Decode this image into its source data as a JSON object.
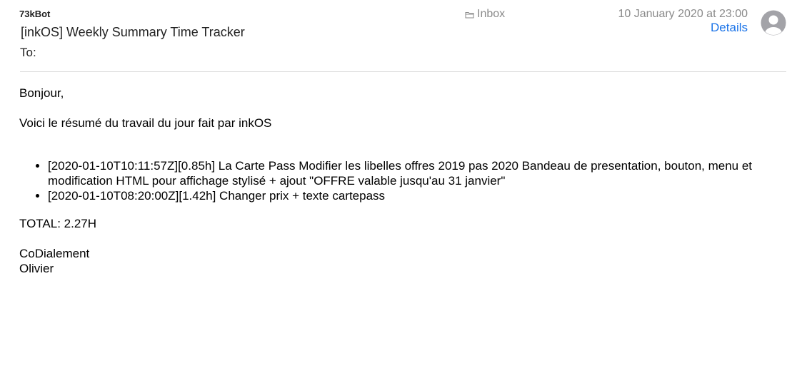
{
  "header": {
    "sender": "73kBot",
    "subject": "[inkOS] Weekly Summary Time Tracker",
    "to_label": "To:",
    "mailbox": {
      "icon": "folder-icon",
      "label": "Inbox"
    },
    "date": "10 January 2020 at 23:00",
    "details_label": "Details",
    "accent_color": "#1a73e8"
  },
  "body": {
    "greeting": "Bonjour,",
    "intro": "Voici le résumé du travail du jour fait par inkOS",
    "tasks": [
      "[2020-01-10T10:11:57Z][0.85h] La Carte Pass Modifier les libelles offres 2019 pas 2020 Bandeau de presentation, bouton, menu et modification HTML pour affichage stylisé + ajout \"OFFRE valable jusqu'au 31 janvier\"",
      "[2020-01-10T08:20:00Z][1.42h] Changer prix + texte cartepass"
    ],
    "total": "TOTAL: 2.27H",
    "signoff": "CoDialement",
    "signature": "Olivier"
  }
}
